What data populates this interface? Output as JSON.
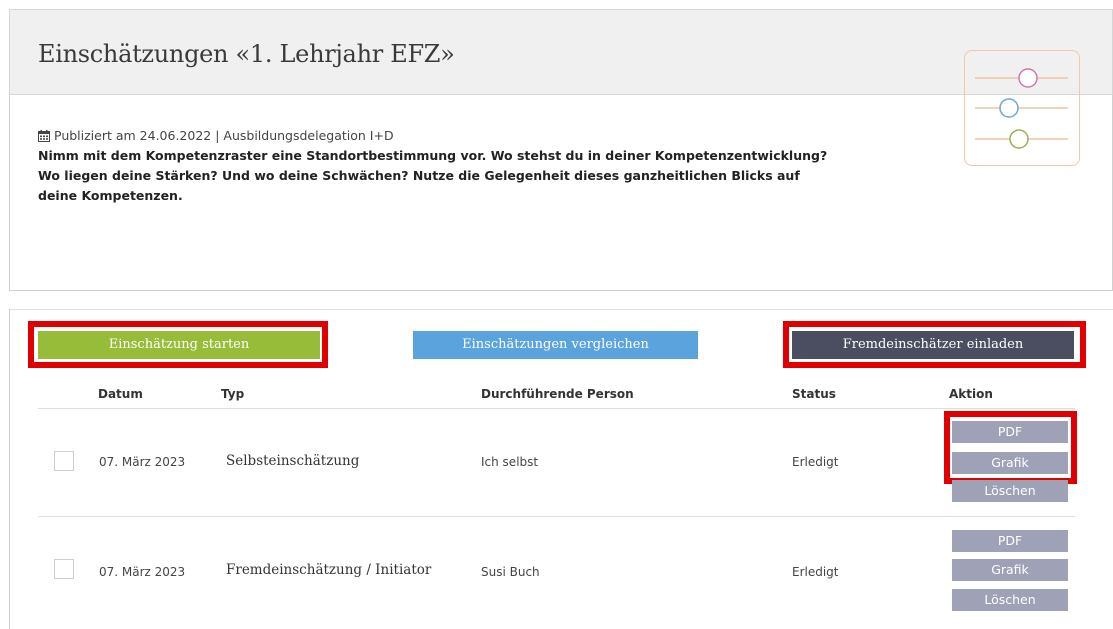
{
  "header": {
    "title": "Einschätzungen «1. Lehrjahr EFZ»"
  },
  "info": {
    "meta": "Publiziert am 24.06.2022 | Ausbildungsdelegation I+D",
    "description": "Nimm mit dem Kompetenzraster eine Standortbestimmung vor. Wo stehst du in deiner Kompetenzentwicklung? Wo liegen deine Stärken? Und wo deine Schwächen? Nutze die Gelegenheit dieses ganzheitlichen Blicks auf deine Kompetenzen.",
    "icon": "sliders-icon",
    "icon_colors": [
      "#c87ab0",
      "#6aa8d8",
      "#9ab050"
    ]
  },
  "actions": {
    "start": "Einschätzung starten",
    "compare": "Einschätzungen vergleichen",
    "invite": "Fremdeinschätzer einladen"
  },
  "table": {
    "headers": {
      "date": "Datum",
      "type": "Typ",
      "person": "Durchführende Person",
      "status": "Status",
      "action": "Aktion"
    },
    "rows": [
      {
        "date": "07. März 2023",
        "type": "Selbsteinschätzung",
        "person": "Ich selbst",
        "status": "Erledigt",
        "buttons": [
          "PDF",
          "Grafik",
          "Löschen"
        ]
      },
      {
        "date": "07. März 2023",
        "type": "Fremdeinschätzung / Initiator",
        "person": "Susi Buch",
        "status": "Erledigt",
        "buttons": [
          "PDF",
          "Grafik",
          "Löschen"
        ]
      }
    ]
  },
  "colors": {
    "green": "#96bc3a",
    "blue": "#5aa3dc",
    "dark": "#4a4e60",
    "action_button": "#9fa2b6",
    "highlight": "#e00000"
  }
}
